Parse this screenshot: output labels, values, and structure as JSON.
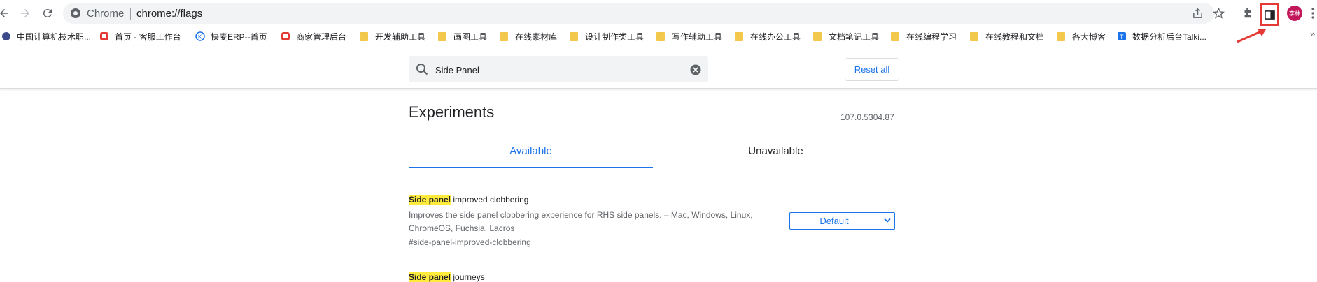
{
  "toolbar": {
    "site_label": "Chrome",
    "url": "chrome://flags"
  },
  "profile": {
    "avatar_text": "李林"
  },
  "bookmarks": [
    {
      "label": "中国计算机技术职...",
      "icon": "site-favicon"
    },
    {
      "label": "首页 - 客服工作台",
      "icon": "site-favicon"
    },
    {
      "label": "快麦ERP--首页",
      "icon": "site-favicon"
    },
    {
      "label": "商家管理后台",
      "icon": "site-favicon"
    },
    {
      "label": "开发辅助工具",
      "icon": "folder"
    },
    {
      "label": "画图工具",
      "icon": "folder"
    },
    {
      "label": "在线素材库",
      "icon": "folder"
    },
    {
      "label": "设计制作类工具",
      "icon": "folder"
    },
    {
      "label": "写作辅助工具",
      "icon": "folder"
    },
    {
      "label": "在线办公工具",
      "icon": "folder"
    },
    {
      "label": "文档笔记工具",
      "icon": "folder"
    },
    {
      "label": "在线编程学习",
      "icon": "folder"
    },
    {
      "label": "在线教程和文档",
      "icon": "folder"
    },
    {
      "label": "各大博客",
      "icon": "folder"
    },
    {
      "label": "数据分析后台Talki...",
      "icon": "site-favicon"
    }
  ],
  "search": {
    "value": "Side Panel",
    "reset_label": "Reset all"
  },
  "main": {
    "title": "Experiments",
    "version": "107.0.5304.87",
    "tabs": [
      {
        "label": "Available"
      },
      {
        "label": "Unavailable"
      }
    ],
    "flags": [
      {
        "highlight": "Side panel",
        "title_rest": " improved clobbering",
        "description": "Improves the side panel clobbering experience for RHS side panels. – Mac, Windows, Linux, ChromeOS, Fuchsia, Lacros",
        "link": "#side-panel-improved-clobbering",
        "select_value": "Default"
      },
      {
        "highlight": "Side panel",
        "title_rest": " journeys"
      }
    ]
  },
  "colors": {
    "accent": "#1a73e8",
    "highlight": "#ffeb3b",
    "annotation": "#e53935"
  }
}
